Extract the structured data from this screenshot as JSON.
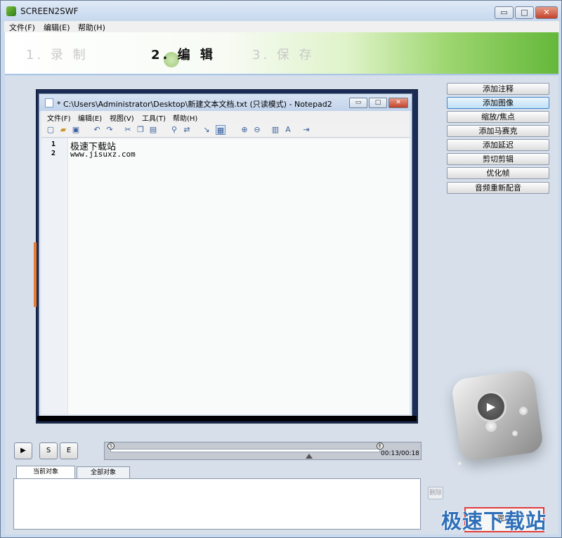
{
  "window": {
    "title": "SCREEN2SWF",
    "controls": {
      "minimize": "▭",
      "maximize": "□",
      "close": "✕"
    }
  },
  "menu": [
    "文件(F)",
    "编辑(E)",
    "帮助(H)"
  ],
  "steps": [
    "1. 录 制",
    "2. 编 辑",
    "3. 保 存"
  ],
  "notepad": {
    "title": "* C:\\Users\\Administrator\\Desktop\\新建文本文档.txt (只读模式) - Notepad2",
    "menu": [
      "文件(F)",
      "编辑(E)",
      "视图(V)",
      "工具(T)",
      "帮助(H)"
    ],
    "lines": [
      {
        "num": "1",
        "text": "极速下载站"
      },
      {
        "num": "2",
        "text": "www.jisuxz.com"
      }
    ],
    "toolbar_icons": [
      "new-icon",
      "open-icon",
      "save-icon",
      "undo-icon",
      "redo-icon",
      "cut-icon",
      "copy-icon",
      "paste-icon",
      "find-icon",
      "replace-icon",
      "wrap-icon",
      "view-icon",
      "zoom-in-icon",
      "zoom-out-icon",
      "scheme-icon",
      "font-icon",
      "exit-icon"
    ]
  },
  "side_buttons": [
    "添加注释",
    "添加图像",
    "缩放/焦点",
    "添加马赛克",
    "添加延迟",
    "剪切剪辑",
    "优化帧",
    "音频重新配音"
  ],
  "active_side_button": 1,
  "playback": {
    "play": "▶",
    "start_marker": "S",
    "end_marker": "E",
    "time": "00:13/00:18",
    "progress": 0.0
  },
  "tabs": [
    "当前对象",
    "全部对象"
  ],
  "delete_label": "删除",
  "finish_label": "完成",
  "watermark": "极速下载站",
  "colors": {
    "accent_green": "#64b83a",
    "highlight_red": "#e23b3b",
    "watermark_blue": "#2e6fb8"
  }
}
